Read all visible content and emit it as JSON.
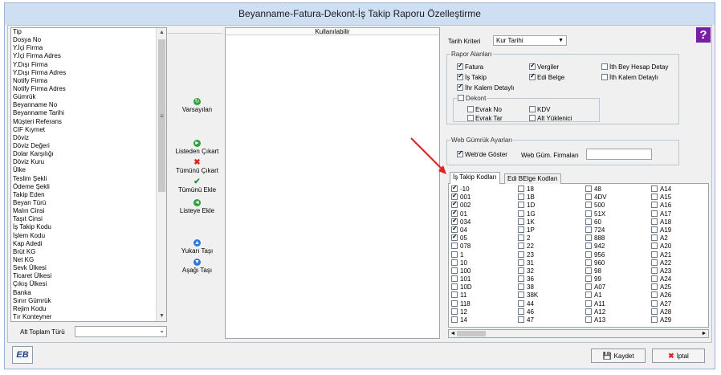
{
  "window": {
    "title": "Beyanname-Fatura-Dekont-İş Takip Raporu Özelleştirme"
  },
  "left_list": {
    "items": [
      "Tip",
      "Dosya No",
      "Y.İçi Firma",
      "Y.İçi Firma Adres",
      "Y.Dışı Firma",
      "Y.Dışı Firma Adres",
      "Notify Firma",
      "Notify Firma Adres",
      "Gümrük",
      "Beyanname No",
      "Beyanname Tarihi",
      "Müşteri Referans",
      "CIF Kıymet",
      "Döviz",
      "Döviz Değeri",
      "Dolar Karşılığı",
      "Döviz Kuru",
      "Ülke",
      "Teslim Şekli",
      "Ödeme Şekli",
      "Takip Eden",
      "Beyan Türü",
      "Malın Cinsi",
      "Taşıt Cinsi",
      "İş Takip Kodu",
      "İşlem Kodu",
      "Kap Adedi",
      "Brüt KG",
      "Net KG",
      "Sevk Ülkesi",
      "Ticaret Ülkesi",
      "Çıkış Ülkesi",
      "Banka",
      "Sınır Gümrük",
      "Rejim Kodu",
      "Tır Konteyner"
    ]
  },
  "alt_toplam": {
    "label": "Alt Toplam Türü",
    "value": ""
  },
  "mid_buttons": {
    "varsayilan": "Varsayılan",
    "listeden_cikart": "Listeden Çıkart",
    "tumunu_cikart": "Tümünü Çıkart",
    "tumunu_ekle": "Tümünü Ekle",
    "listeye_ekle": "Listeye Ekle",
    "yukari_tasi": "Yukarı Taşı",
    "asagi_tasi": "Aşağı Taşı"
  },
  "user_list": {
    "header": "Kullanılabilir"
  },
  "tarih_kriteri": {
    "label": "Tarih Kriteri",
    "value": "Kur Tarihi"
  },
  "rapor_alanlari": {
    "legend": "Rapor Alanları",
    "fatura": "Fatura",
    "vergiler": "Vergiler",
    "ith_bey_hesap": "İth Bey Hesap Detay",
    "is_takip": "İş Takip",
    "edi_belge": "Edi Belge",
    "ith_kalem": "İth Kalem Detaylı",
    "ihr_kalem": "İhr Kalem Detaylı",
    "dekont": "Dekont",
    "evrak_no": "Evrak No",
    "kdv": "KDV",
    "evrak_tar": "Evrak Tar",
    "alt_yuklenici": "Alt Yüklenici"
  },
  "web_gumruk": {
    "legend": "Web Gümrük Ayarları",
    "webde_goster": "Web'de Göster",
    "firmalar_label": "Web Güm. Firmaları",
    "firmalar_value": ""
  },
  "tabs": [
    "İş Takip Kodları",
    "Edi BElge Kodları"
  ],
  "codes": {
    "col1": [
      [
        "-10",
        true
      ],
      [
        "001",
        true
      ],
      [
        "002",
        true
      ],
      [
        "01",
        true
      ],
      [
        "034",
        true
      ],
      [
        "04",
        true
      ],
      [
        "05",
        true
      ],
      [
        "078",
        false
      ],
      [
        "1",
        false
      ],
      [
        "10",
        false
      ],
      [
        "100",
        false
      ],
      [
        "101",
        false
      ],
      [
        "10D",
        false
      ],
      [
        "11",
        false
      ],
      [
        "118",
        false
      ],
      [
        "12",
        false
      ],
      [
        "14",
        false
      ]
    ],
    "col2": [
      "18",
      "1B",
      "1D",
      "1G",
      "1K",
      "1P",
      "2",
      "22",
      "23",
      "31",
      "32",
      "36",
      "38",
      "38K",
      "44",
      "46",
      "47"
    ],
    "col3": [
      "48",
      "4DV",
      "500",
      "51X",
      "60",
      "724",
      "888",
      "942",
      "956",
      "960",
      "98",
      "99",
      "A07",
      "A1",
      "A11",
      "A12",
      "A13"
    ],
    "col4": [
      "A14",
      "A15",
      "A16",
      "A17",
      "A18",
      "A19",
      "A2",
      "A20",
      "A21",
      "A22",
      "A23",
      "A24",
      "A25",
      "A26",
      "A27",
      "A28",
      "A29"
    ]
  },
  "footer": {
    "kaydet": "Kaydet",
    "iptal": "İptal",
    "eb_label": "EB"
  },
  "colors": {
    "title_bg": "#cfdff3",
    "help": "#7a1fa3",
    "annotation": "#e02020"
  }
}
